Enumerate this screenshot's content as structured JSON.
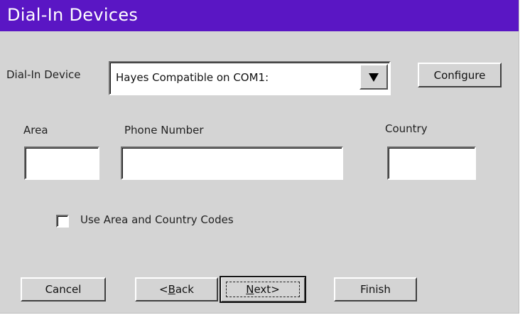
{
  "window": {
    "title": "Dial-In Devices"
  },
  "device": {
    "label": "Dial-In Device",
    "selected": "Hayes Compatible on COM1:",
    "configure_label": "Configure"
  },
  "fields": {
    "area_label": "Area",
    "area_value": "",
    "phone_label": "Phone Number",
    "phone_value": "",
    "country_label": "Country",
    "country_value": ""
  },
  "options": {
    "use_codes_label": "Use Area and Country Codes",
    "use_codes_checked": false
  },
  "buttons": {
    "cancel": "Cancel",
    "back_prefix": "<",
    "back_mnemonic": "B",
    "back_rest": "ack",
    "next_mnemonic": "N",
    "next_rest": "ext>",
    "finish": "Finish"
  },
  "icons": {
    "dropdown": "triangle-down-icon"
  }
}
